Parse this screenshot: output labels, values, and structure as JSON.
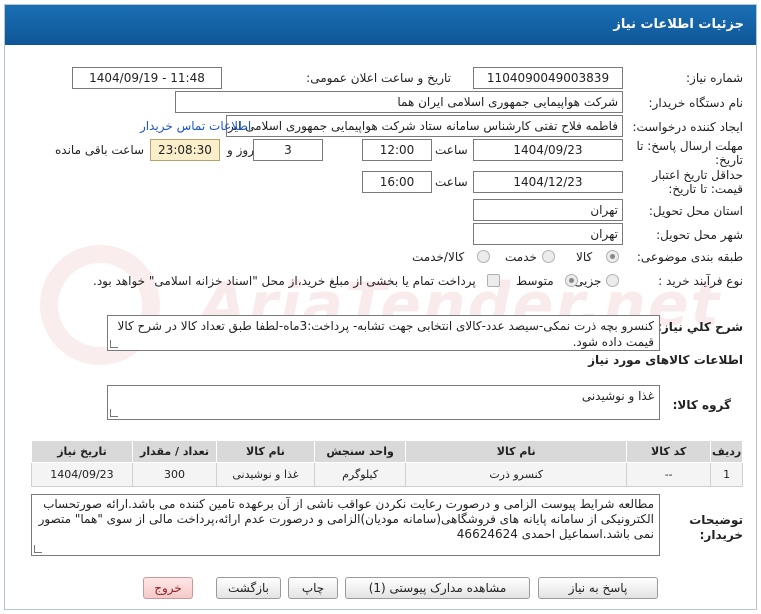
{
  "header": {
    "title": "جزئیات اطلاعات نیاز"
  },
  "form": {
    "need_number_label": "شماره نیاز:",
    "need_number": "1104090049003839",
    "announce_label": "تاریخ و ساعت اعلان عمومی:",
    "announce_value": "1404/09/19 - 11:48",
    "buyer_org_label": "نام دستگاه خریدار:",
    "buyer_org": "شرکت هواپیمایی جمهوری اسلامی ایران هما",
    "creator_label": "ایجاد کننده درخواست:",
    "creator": "فاطمه فلاح تفتی کارشناس سامانه ستاد شرکت هواپیمایی جمهوری اسلامی ایران",
    "contact_link": "اطلاعات تماس خریدار",
    "deadline_label_1": "مهلت ارسال پاسخ: تا",
    "deadline_label_2": "تاریخ:",
    "deadline_date": "1404/09/23",
    "time_label": "ساعت",
    "deadline_time": "12:00",
    "days_value": "3",
    "days_label": "روز و",
    "remaining_time": "23:08:30",
    "remaining_label": "ساعت باقی مانده",
    "validity_label_1": "حداقل تاریخ اعتبار",
    "validity_label_2": "قیمت: تا تاریخ:",
    "validity_date": "1404/12/23",
    "validity_time": "16:00",
    "province_label": "استان محل تحویل:",
    "province": "تهران",
    "city_label": "شهر محل تحویل:",
    "city": "تهران",
    "category_label": "طبقه بندی موضوعی:",
    "category_options": [
      "کالا",
      "خدمت",
      "کالا/خدمت"
    ],
    "process_label": "نوع فرآیند خرید :",
    "process_options": [
      "جزیی",
      "متوسط"
    ],
    "payment_note": "پرداخت تمام یا بخشی از مبلغ خرید،از محل \"اسناد خزانه اسلامی\" خواهد بود.",
    "summary_label": "شرح کلي نياز:",
    "summary": "کنسرو بچه ذرت نمکی-سیصد عدد-کالای انتخابی جهت تشابه- پرداخت:3ماه-لطفا طبق تعداد کالا در شرح کالا قیمت داده شود.",
    "goods_info_title": "اطلاعات کالاهای مورد نیاز",
    "goods_group_label": "گروه کالا:",
    "goods_group": "غذا و نوشیدنی"
  },
  "table": {
    "headers": [
      "ردیف",
      "کد کالا",
      "نام کالا",
      "واحد سنجش",
      "نام کالا",
      "تعداد / مقدار",
      "تاریخ نیاز"
    ],
    "rows": [
      [
        "1",
        "--",
        "کنسرو ذرت",
        "کیلوگرم",
        "غذا و نوشیدنی",
        "300",
        "1404/09/23"
      ]
    ]
  },
  "notes": {
    "label_1": "توضیحات",
    "label_2": "خریدار:",
    "text": "مطالعه شرایط پیوست الزامی و درصورت رعایت نکردن عواقب ناشی از آن برعهده تامین کننده می باشد.ارائه صورتحساب الکترونیکی از سامانه پایانه های فروشگاهی(سامانه مودیان)الزامی و درصورت عدم ارائه،پرداخت مالی از سوی \"هما\" متصور نمی باشد.اسماعیل احمدی 46624624"
  },
  "buttons": {
    "reply": "پاسخ به نیاز",
    "attachments": "مشاهده مدارک پیوستی (1)",
    "print": "چاپ",
    "back": "بازگشت",
    "exit": "خروج"
  },
  "colors": {
    "titlebar": "#1a6fb4",
    "remaining_bg": "#fbeecb",
    "link": "#1a55c8",
    "exit_button": "#f5c9c9"
  }
}
